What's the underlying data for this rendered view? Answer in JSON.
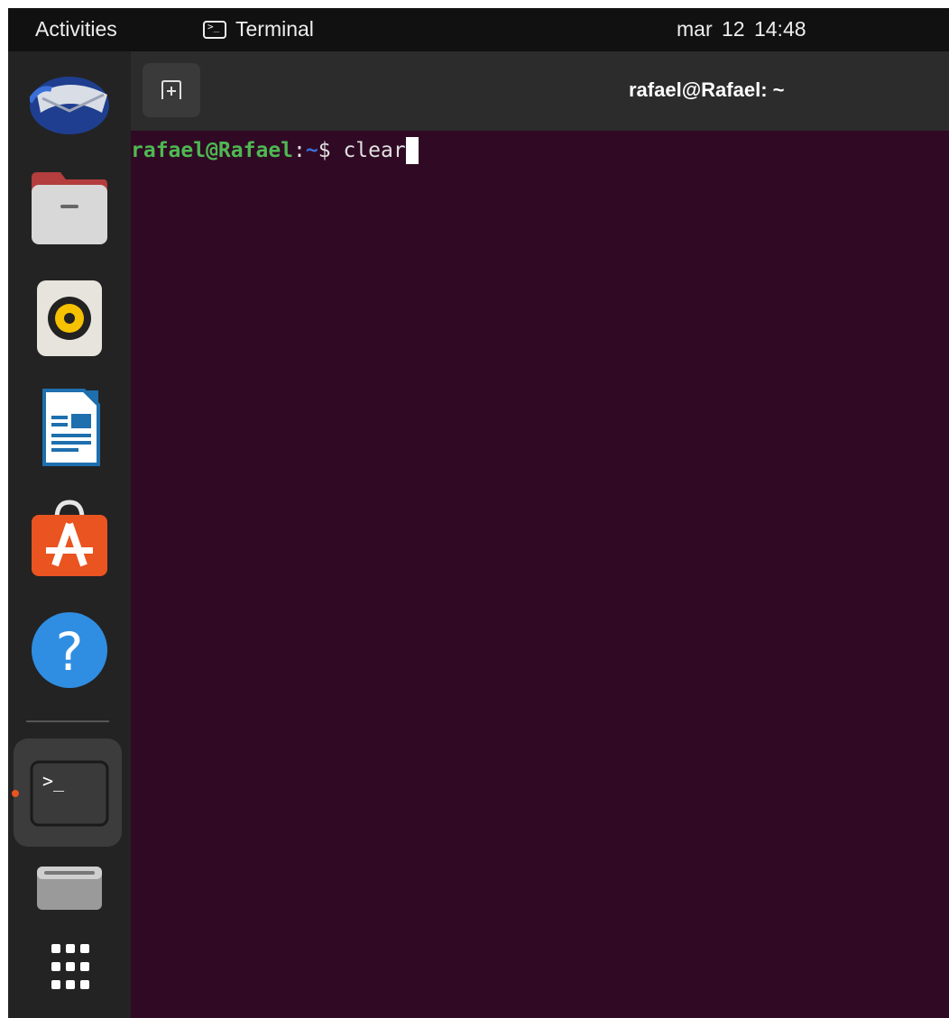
{
  "topbar": {
    "activities_label": "Activities",
    "app_menu_label": "Terminal",
    "app_menu_icon": "terminal-small-icon",
    "clock": "mar 12  14:48"
  },
  "dock": {
    "items": [
      {
        "name": "thunderbird",
        "icon": "mail-client-icon"
      },
      {
        "name": "files",
        "icon": "folder-icon"
      },
      {
        "name": "rhythmbox",
        "icon": "speaker-icon"
      },
      {
        "name": "libreoffice-writer",
        "icon": "document-icon"
      },
      {
        "name": "ubuntu-software",
        "icon": "shopping-bag-icon"
      },
      {
        "name": "help",
        "icon": "question-icon"
      },
      {
        "name": "terminal",
        "icon": "terminal-icon",
        "running": true
      },
      {
        "name": "disk-drive",
        "icon": "drive-icon"
      },
      {
        "name": "show-applications",
        "icon": "app-grid-icon"
      }
    ]
  },
  "terminal": {
    "window_title": "rafael@Rafael: ~",
    "newtab_icon": "new-tab-icon",
    "prompt_user": "rafael@Rafael",
    "prompt_colon": ":",
    "prompt_path": "~",
    "prompt_symbol": "$ ",
    "command": "clear"
  },
  "colors": {
    "terminal_bg": "#300a24",
    "topbar_bg": "#111111",
    "dock_bg": "#232323",
    "accent": "#e95420",
    "prompt_user": "#4eb852",
    "prompt_path": "#3a6fd8"
  }
}
